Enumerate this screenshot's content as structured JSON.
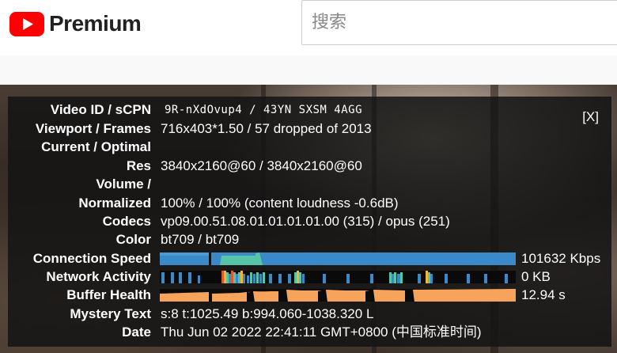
{
  "header": {
    "brand_text": "Premium",
    "brand_color": "#ff0000",
    "logo_icon": "youtube-play-icon",
    "search_placeholder": "搜索"
  },
  "stats": {
    "close_label": "[X]",
    "video_id_label": "Video ID / sCPN",
    "video_id_value": "9R-nXdOvup4 / 43YN SXSM 4AGG",
    "viewport_label": "Viewport / Frames",
    "viewport_value": "716x403*1.50 / 57 dropped of 2013",
    "current_optimal_label": "Current / Optimal",
    "res_label": "Res",
    "res_value": "3840x2160@60 / 3840x2160@60",
    "volume_label": "Volume /",
    "normalized_label": "Normalized",
    "volume_value": "100% / 100% (content loudness -0.6dB)",
    "codecs_label": "Codecs",
    "codecs_value": "vp09.00.51.08.01.01.01.01.00 (315) / opus (251)",
    "color_label": "Color",
    "color_value": "bt709 / bt709",
    "connection_label": "Connection Speed",
    "connection_value": "101632 Kbps",
    "network_label": "Network Activity",
    "network_value": "0 KB",
    "buffer_label": "Buffer Health",
    "buffer_value": "12.94 s",
    "mystery_label": "Mystery Text",
    "mystery_value": "s:8 t:1025.49 b:994.060-1038.320 L",
    "date_label": "Date",
    "date_value": "Thu Jun 02 2022 22:41:11 GMT+0800 (中国标准时间)"
  },
  "colors": {
    "connection_bar": "#3a89c9",
    "connection_peak": "#56c4a6",
    "buffer_bar": "#f7a35c",
    "panel_bg": "#141414"
  }
}
